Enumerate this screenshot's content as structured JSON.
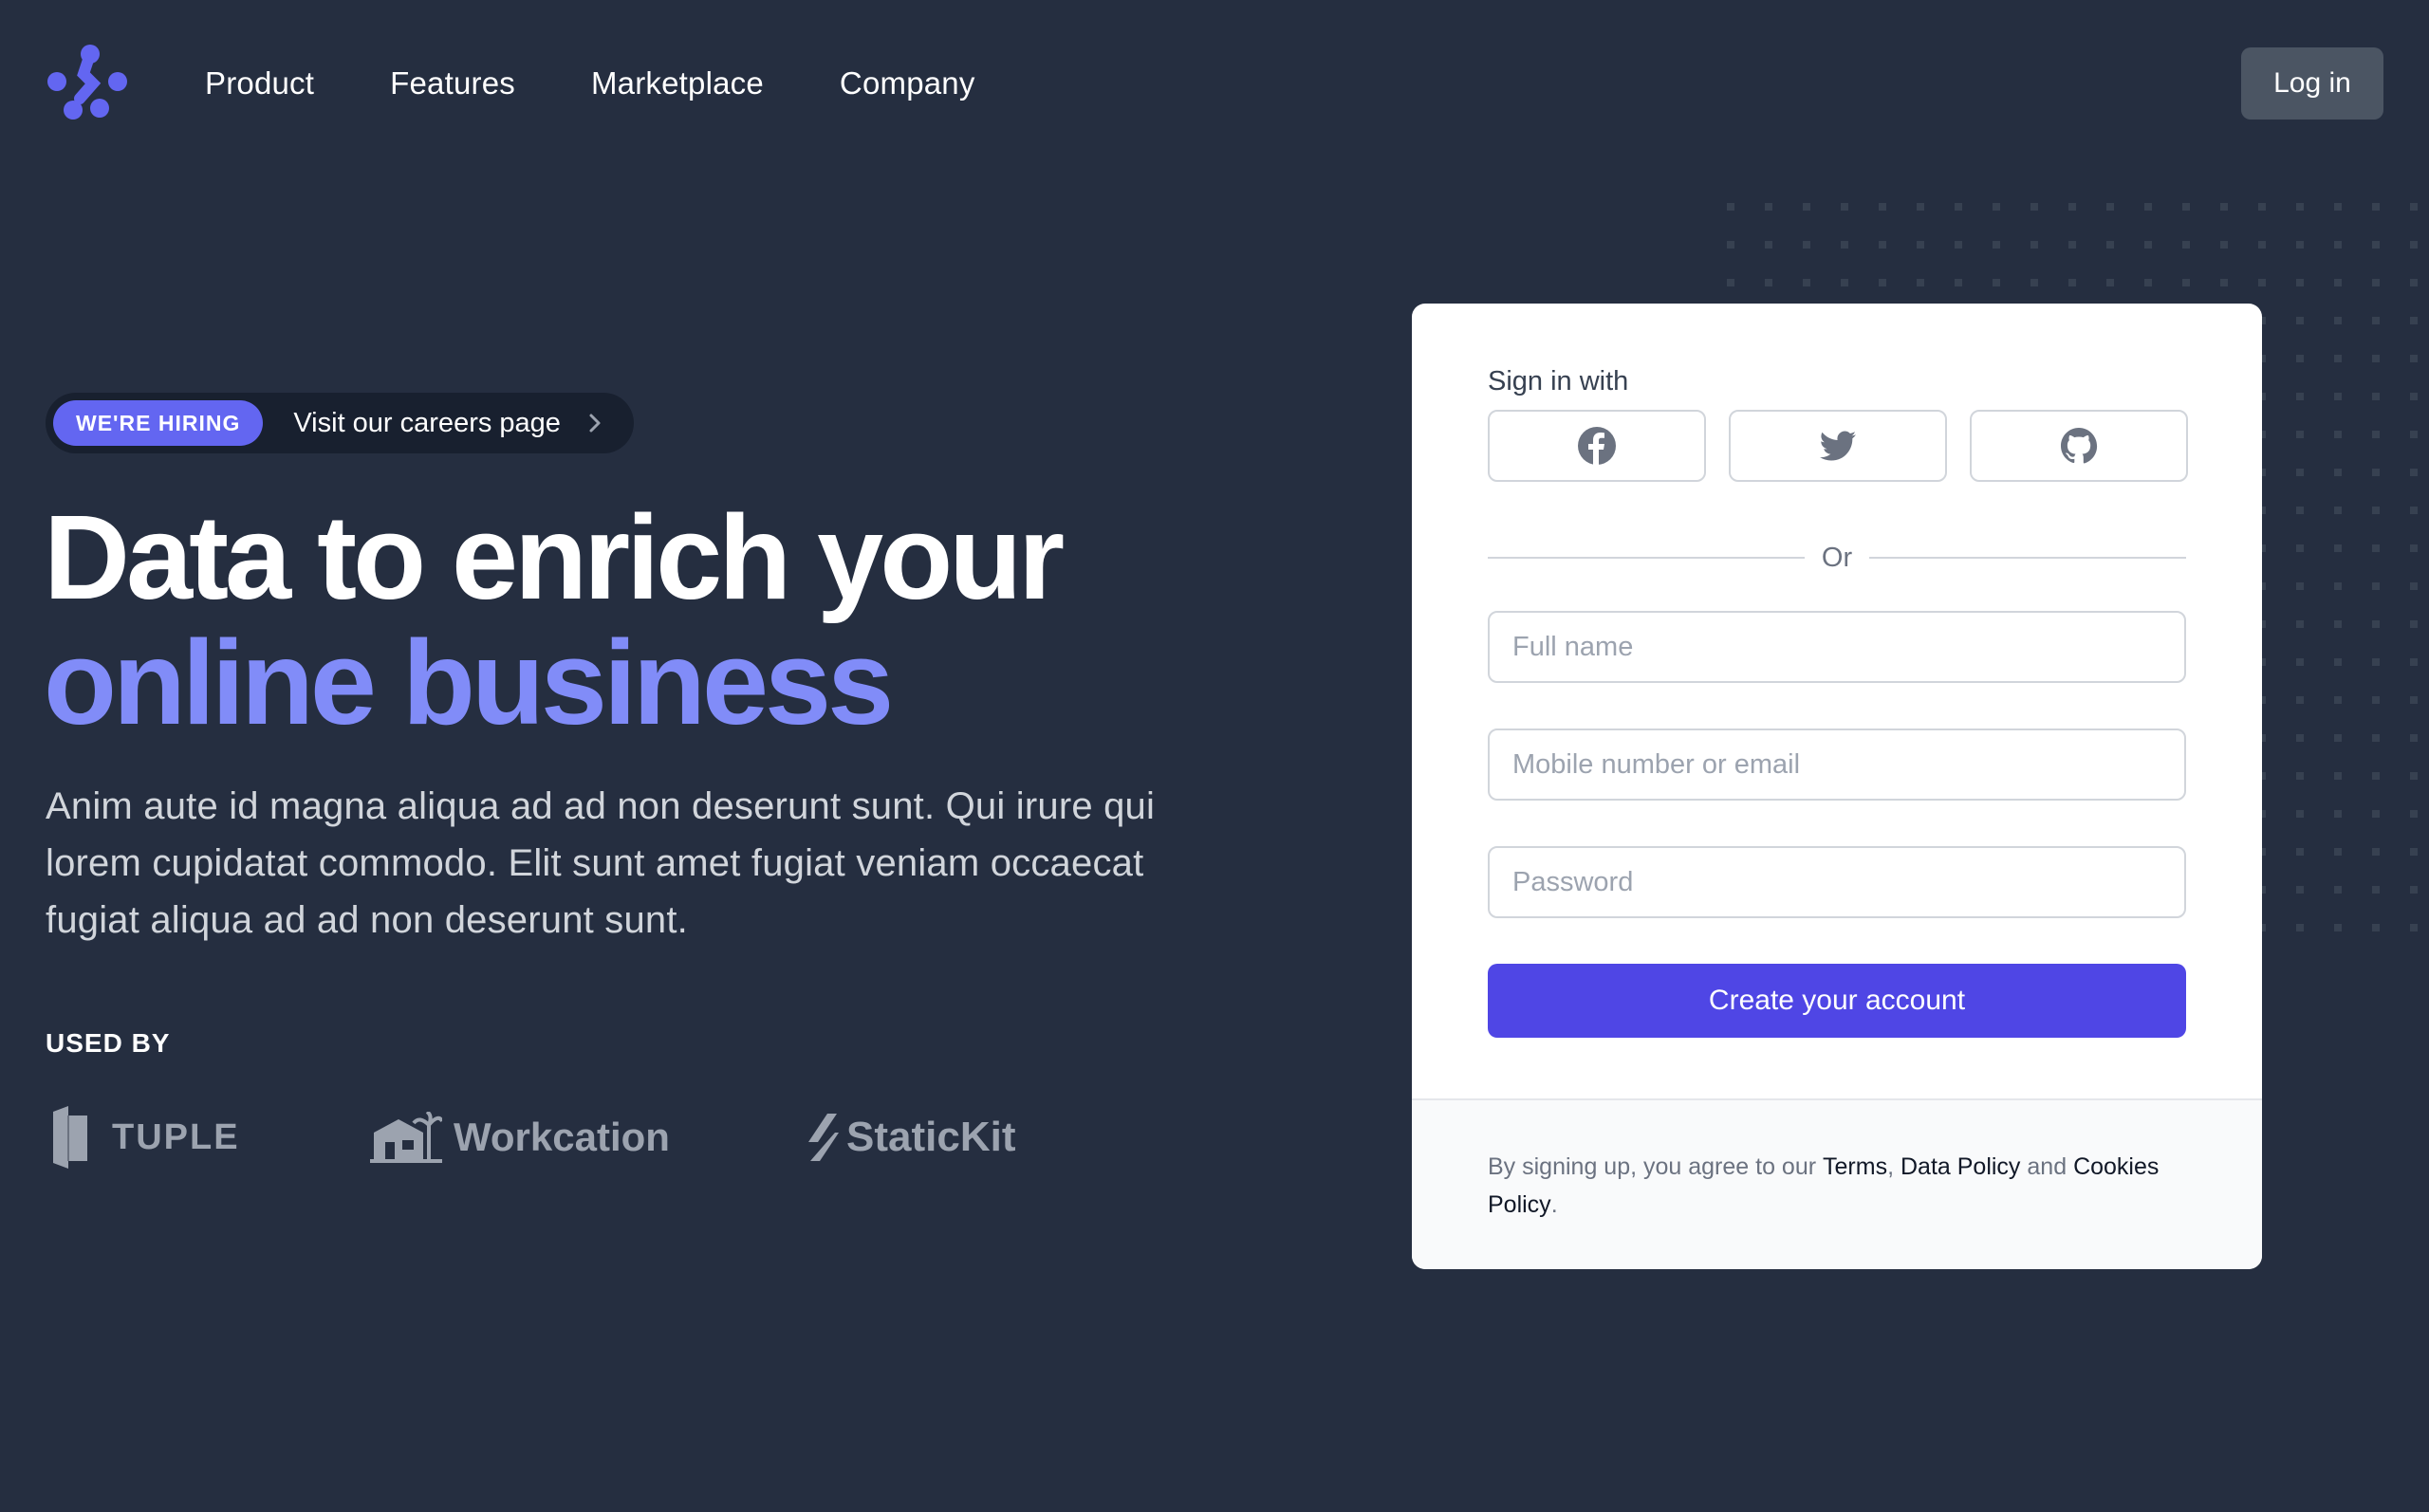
{
  "header": {
    "nav": [
      "Product",
      "Features",
      "Marketplace",
      "Company"
    ],
    "login_label": "Log in"
  },
  "hero": {
    "badge": "WE'RE HIRING",
    "careers_link": "Visit our careers page",
    "title_line1": "Data to enrich your",
    "title_line2": "online business",
    "description": "Anim aute id magna aliqua ad ad non deserunt sunt. Qui irure qui lorem cupidatat commodo. Elit sunt amet fugiat veniam occaecat fugiat aliqua ad ad non deserunt sunt.",
    "used_by": "USED BY",
    "clients": [
      "TUPLE",
      "Workcation",
      "StaticKit"
    ]
  },
  "signup": {
    "sign_in_with": "Sign in with",
    "social": [
      "facebook-icon",
      "twitter-icon",
      "github-icon"
    ],
    "or": "Or",
    "full_name_placeholder": "Full name",
    "contact_placeholder": "Mobile number or email",
    "password_placeholder": "Password",
    "submit_label": "Create your account",
    "terms_prefix": "By signing up, you agree to our",
    "terms_link": "Terms",
    "comma": ",",
    "data_policy_link": "Data Policy",
    "and": "and",
    "cookies_link": "Cookies Policy",
    "period": "."
  },
  "colors": {
    "background": "#252e40",
    "accent": "#4f46e5",
    "accent_light": "#818cf8",
    "badge": "#6366f1"
  }
}
